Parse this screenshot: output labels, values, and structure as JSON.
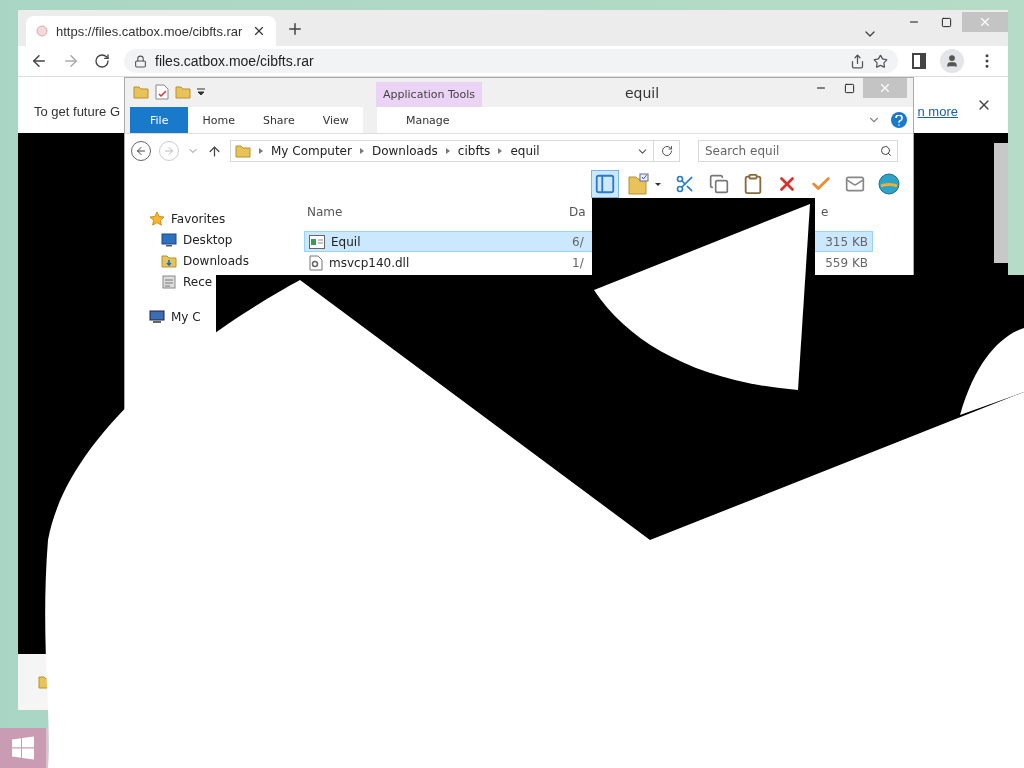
{
  "browser": {
    "tab": {
      "title": "https://files.catbox.moe/cibfts.rar"
    },
    "address": "files.catbox.moe/cibfts.rar",
    "infobar": {
      "text": "To get future G",
      "link": "n more"
    }
  },
  "explorer": {
    "title": "equil",
    "contextual_group": "Application Tools",
    "ribbon_tabs": [
      {
        "label": "File",
        "kind": "file"
      },
      {
        "label": "Home",
        "kind": "tab"
      },
      {
        "label": "Share",
        "kind": "tab"
      },
      {
        "label": "View",
        "kind": "tab"
      },
      {
        "label": "Manage",
        "kind": "contextual"
      }
    ],
    "breadcrumbs": [
      "My Computer",
      "Downloads",
      "cibfts",
      "equil"
    ],
    "search": {
      "placeholder": "Search equil"
    },
    "toolbar": [
      {
        "kind": "layout",
        "selected": true
      },
      {
        "kind": "properties",
        "selected": false
      },
      {
        "kind": "cut",
        "selected": false
      },
      {
        "kind": "copy",
        "selected": false
      },
      {
        "kind": "paste",
        "selected": false
      },
      {
        "kind": "delete",
        "selected": false
      },
      {
        "kind": "check",
        "selected": false
      },
      {
        "kind": "mail",
        "selected": false
      },
      {
        "kind": "globe",
        "selected": false
      }
    ],
    "sidebar": [
      {
        "label": "Favorites",
        "kind": "favorites",
        "children": [
          {
            "label": "Desktop",
            "kind": "desktop"
          },
          {
            "label": "Downloads",
            "kind": "downloads"
          },
          {
            "label": "Rece",
            "kind": "recent"
          }
        ]
      },
      {
        "label": "My C",
        "kind": "computer"
      }
    ],
    "columns": [
      "Name",
      "Da",
      "e"
    ],
    "files": [
      {
        "name": "Equil",
        "date": "6/",
        "size": "315 KB",
        "kind": "app",
        "selected": true
      },
      {
        "name": "msvcp140.dll",
        "date": "1/",
        "size": "559 KB",
        "kind": "dll",
        "selected": false
      }
    ]
  }
}
